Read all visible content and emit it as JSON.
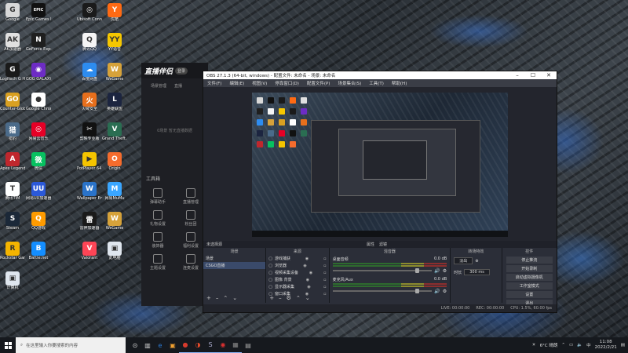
{
  "desktop": {
    "icons": [
      {
        "label": "Google",
        "color": "#d8d8d8",
        "glyph": "G"
      },
      {
        "label": "Epic Games Launcher",
        "color": "#111111",
        "glyph": "EPIC"
      },
      {
        "label": "Ubisoft Connect",
        "color": "#1a1a1a",
        "glyph": "◎"
      },
      {
        "label": "优酷",
        "color": "#ff6a13",
        "glyph": "Y"
      },
      {
        "label": "AK加速器",
        "color": "#e0e0e0",
        "glyph": "AK"
      },
      {
        "label": "GeForce Experience",
        "color": "#1f1f1f",
        "glyph": "N"
      },
      {
        "label": "腾讯QQ",
        "color": "#f5f5f5",
        "glyph": "Q"
      },
      {
        "label": "YY语音",
        "color": "#f6c700",
        "glyph": "YY"
      },
      {
        "label": "Logitech G HUB",
        "color": "#1a1a1a",
        "glyph": "G"
      },
      {
        "label": "GOG GALAXY",
        "color": "#6d2cc4",
        "glyph": "◉"
      },
      {
        "label": "百度网盘",
        "color": "#2d8cf0",
        "glyph": "☁"
      },
      {
        "label": "WeGame",
        "color": "#d6a23a",
        "glyph": "W"
      },
      {
        "label": "Counter-Global Offen...",
        "color": "#d9a021",
        "glyph": "GO"
      },
      {
        "label": "Google Chrome",
        "color": "#ffffff",
        "glyph": "●"
      },
      {
        "label": "火绒安全",
        "color": "#e76f1c",
        "glyph": "火"
      },
      {
        "label": "英雄联盟",
        "color": "#1c2540",
        "glyph": "L"
      },
      {
        "label": "猎豹",
        "color": "#4b6b8a",
        "glyph": "猎"
      },
      {
        "label": "网易云音乐",
        "color": "#e60026",
        "glyph": "◎"
      },
      {
        "label": "剪映专业版",
        "color": "#111111",
        "glyph": "✂"
      },
      {
        "label": "Grand Theft Auto V",
        "color": "#2a6e52",
        "glyph": "V"
      },
      {
        "label": "Apex Legends",
        "color": "#c0272d",
        "glyph": "A"
      },
      {
        "label": "微信",
        "color": "#07c160",
        "glyph": "微"
      },
      {
        "label": "PotPlayer 64 bit",
        "color": "#f5c400",
        "glyph": "▶"
      },
      {
        "label": "Origin",
        "color": "#f56c2d",
        "glyph": "O"
      },
      {
        "label": "腾讯TIM",
        "color": "#ffffff",
        "glyph": "T"
      },
      {
        "label": "网易UU加速器",
        "color": "#2b59d9",
        "glyph": "UU"
      },
      {
        "label": "Wallpaper Engine",
        "color": "#2a73c9",
        "glyph": "W"
      },
      {
        "label": "网易MuMu",
        "color": "#3aa6ff",
        "glyph": "M"
      },
      {
        "label": "Steam",
        "color": "#1b2838",
        "glyph": "S"
      },
      {
        "label": "QQ游戏",
        "color": "#ff9b00",
        "glyph": "Q"
      },
      {
        "label": "雷神加速器",
        "color": "#1a1a1a",
        "glyph": "雷"
      },
      {
        "label": "WeGame",
        "color": "#d6a23a",
        "glyph": "W"
      },
      {
        "label": "Rockstar Games",
        "color": "#f4b400",
        "glyph": "R"
      },
      {
        "label": "Battle.net",
        "color": "#148eff",
        "glyph": "B"
      },
      {
        "label": "Valorant",
        "color": "#fd4556",
        "glyph": "V"
      },
      {
        "label": "此电脑",
        "color": "#dfe6ee",
        "glyph": "▣"
      },
      {
        "label": "计算机",
        "color": "#dfe6ee",
        "glyph": "▣"
      }
    ]
  },
  "companion": {
    "logo": "直播伴侣",
    "badge": "登录",
    "tabs": [
      "场景管理",
      "直播"
    ],
    "note": "0场景 暂无直播数据",
    "tools_title": "工具箱",
    "tools": [
      "弹幕助手",
      "直播管理",
      "礼物设置",
      "粉丝团",
      "装饰器",
      "福利设置",
      "主题设置",
      "连麦设置"
    ]
  },
  "obs": {
    "title": "OBS 27.1.3 (64-bit, windows) - 配置文件: 未命名 - 场景: 未命名",
    "menu": [
      "文件(F)",
      "编辑(E)",
      "视图(V)",
      "停靠窗口(D)",
      "配置文件(P)",
      "场景集合(S)",
      "工具(T)",
      "帮助(H)"
    ],
    "docks": {
      "scenes": "场景",
      "sources": "来源",
      "mixer": "混音器",
      "transitions": "转场特效",
      "controls": "控件"
    },
    "no_source": "未选择源",
    "props_button": "属性",
    "filters_button": "滤镜",
    "scenes": [
      "场景",
      "CSGO直播"
    ],
    "sources": [
      {
        "name": "游戏捕获",
        "icon": "▢"
      },
      {
        "name": "浏览器",
        "icon": "▢"
      },
      {
        "name": "视频采集设备",
        "icon": "▢"
      },
      {
        "name": "图像 背景",
        "icon": "▢"
      },
      {
        "name": "显示器采集",
        "icon": "▢"
      },
      {
        "name": "窗口采集",
        "icon": "▢"
      }
    ],
    "mixer": [
      {
        "name": "桌面音频",
        "db": "0.0 dB"
      },
      {
        "name": "麦克风/Aux",
        "db": "0.0 dB"
      }
    ],
    "transition": {
      "type": "淡出",
      "duration_label": "时长",
      "duration": "300 ms"
    },
    "controls": [
      "停止推流",
      "开始录制",
      "启动虚拟摄像机",
      "工作室模式",
      "设置",
      "退出"
    ],
    "status": {
      "live": "LIVE: 00:00:00",
      "rec": "REC: 00:00:00",
      "cpu": "CPU: 1.5%, 60.00 fps"
    }
  },
  "taskbar": {
    "search_placeholder": "在这里输入你要搜索的内容",
    "apps": [
      "⊙",
      "▥",
      "e",
      "▣",
      "●",
      "◑",
      "S",
      "◉",
      "▦",
      "▤"
    ],
    "weather": "6°C  晴朗",
    "time": "11:08",
    "date": "2022/2/21"
  }
}
